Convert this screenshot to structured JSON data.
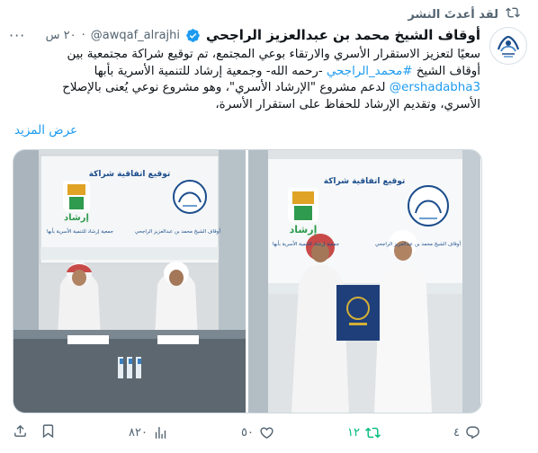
{
  "retweet_banner": {
    "text": "لقد أعدتَ النشر"
  },
  "author": {
    "display_name": "أوقاف الشيخ محمد بن عبدالعزيز الراجحي",
    "handle": "@awqaf_alrajhi",
    "separator": "·",
    "time": "٢٠ س"
  },
  "tweet": {
    "line1": "سعيًا لتعزيز الاستقرار الأسري والارتقاء بوعي المجتمع، تم توقيع شراكة مجتمعية بين",
    "line2_pre": "أوقاف الشيخ ",
    "line2_hashtag": "#محمد_الراجحي",
    "line2_post": " -رحمه الله- وجمعية إرشاد للتنمية الأسرية بأبها",
    "line3_mention": "@ershadabha3",
    "line3_post": " لدعم مشروع \"الإرشاد الأسري\"، وهو مشروع نوعي يُعنى بالإصلاح",
    "line4": "الأسري، وتقديم الإرشاد للحفاظ على استقرار الأسرة،",
    "show_more": "عرض المزيد"
  },
  "media": {
    "photo1": {
      "banner_title": "توقيع اتفاقية شراكة",
      "partner_logo_text": "إرشاد",
      "partner_caption": "جمعية إرشاد للتنمية الأسرية بأبها",
      "host_caption": "أوقاف الشيخ محمد بن عبدالعزيز الراجحي"
    },
    "photo2": {
      "banner_title": "توقيع اتفاقية شراكة",
      "partner_logo_text": "إرشاد",
      "partner_caption": "جمعية إرشاد للتنمية الأسرية بأبها",
      "host_caption": "أوقاف الشيخ محمد بن عبدالعزيز الراجحي"
    }
  },
  "actions": {
    "replies": "٤",
    "retweets": "١٢",
    "likes": "٥٠",
    "views": "٨٢٠"
  },
  "colors": {
    "accent": "#1d9bf0",
    "retweet_green": "#00ba7c",
    "muted": "#536471",
    "text": "#0f1419",
    "banner_green": "#1f8a4c"
  }
}
